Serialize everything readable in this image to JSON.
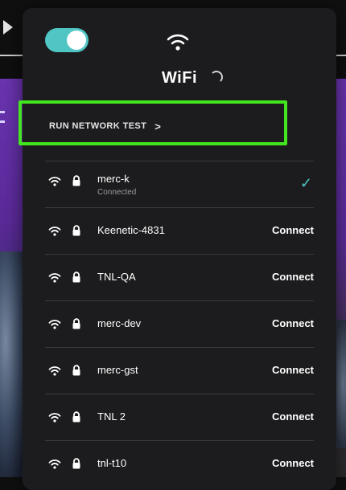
{
  "header": {
    "title": "WiFi",
    "toggle_on": true
  },
  "network_test": {
    "label": "RUN NETWORK TEST",
    "chevron": ">"
  },
  "networks": [
    {
      "name": "merc-k",
      "status": "Connected",
      "action": "",
      "connected": true
    },
    {
      "name": "Keenetic-4831",
      "status": "",
      "action": "Connect",
      "connected": false
    },
    {
      "name": "TNL-QA",
      "status": "",
      "action": "Connect",
      "connected": false
    },
    {
      "name": "merc-dev",
      "status": "",
      "action": "Connect",
      "connected": false
    },
    {
      "name": "merc-gst",
      "status": "",
      "action": "Connect",
      "connected": false
    },
    {
      "name": "TNL 2",
      "status": "",
      "action": "Connect",
      "connected": false
    },
    {
      "name": "tnl-t10",
      "status": "",
      "action": "Connect",
      "connected": false
    }
  ],
  "colors": {
    "accent": "#4fc6c4",
    "highlight": "#43e61e",
    "panel": "#1c1c1e"
  },
  "icons": {
    "wifi": "wifi-icon",
    "lock": "lock-icon",
    "check": "check-icon",
    "play": "play-icon"
  }
}
